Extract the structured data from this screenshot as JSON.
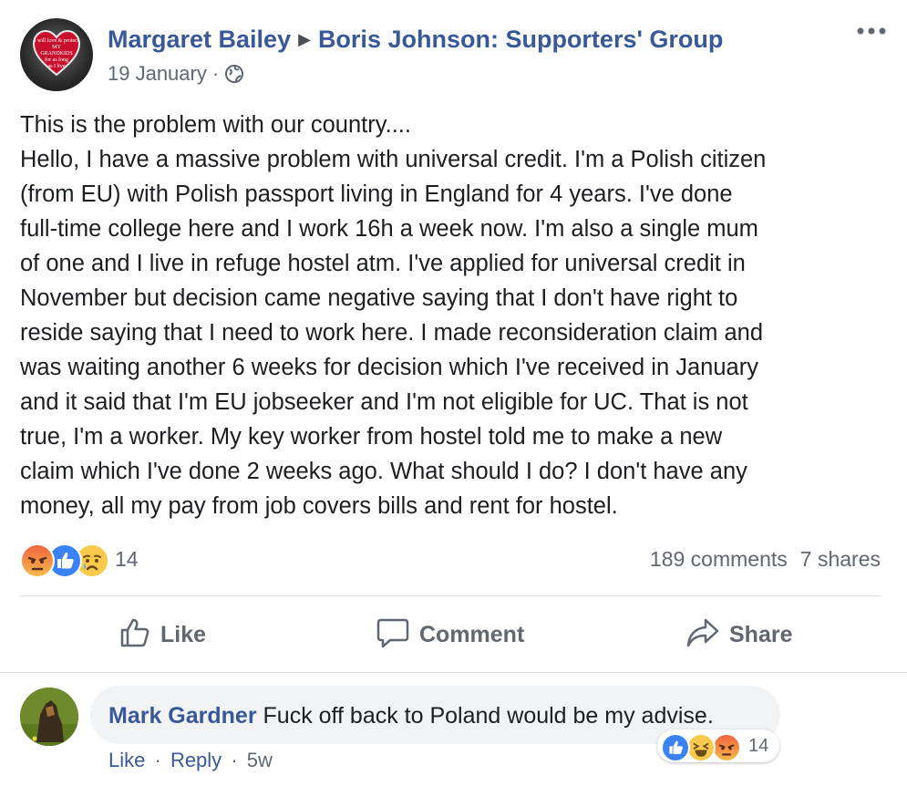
{
  "post": {
    "author": "Margaret Bailey",
    "group": "Boris Johnson: Supporters' Group",
    "date": "19 January",
    "date_separator": "·",
    "privacy_icon": "globe-icon",
    "more_icon": "more-options-icon",
    "avatar_text": [
      "I will love & protect",
      "MY",
      "GRANDKIDS",
      "for as long",
      "as I live"
    ],
    "body": [
      "This is the problem with our country....",
      "Hello, I have a massive problem with universal credit. I'm a Polish citizen",
      "(from EU) with Polish passport living in England for 4 years. I've done",
      "full-time college here and I work 16h a week now. I'm also a single mum",
      "of one and I live in refuge hostel atm. I've applied for universal credit in",
      "November but decision came negative saying that I don't have right to",
      "reside saying that I need to work here. I made reconsideration claim and",
      "was waiting another 6 weeks for decision which I've received in January",
      "and it said that I'm EU jobseeker and I'm not eligible for UC. That is not",
      "true, I'm a worker. My key worker from hostel told me to make a new",
      "claim which I've done 2 weeks ago. What should I do? I don't have any",
      "money, all my pay from job covers bills and rent for hostel."
    ],
    "reactions": [
      "angry",
      "like",
      "sad"
    ],
    "reaction_count": "14",
    "comments_count": "189 comments",
    "shares_count": "7 shares"
  },
  "actions": {
    "like": "Like",
    "comment": "Comment",
    "share": "Share"
  },
  "comment": {
    "author": "Mark Gardner",
    "text": "Fuck off back to Poland would be my advise.",
    "reactions": [
      "like",
      "haha",
      "angry"
    ],
    "reaction_count": "14",
    "like_label": "Like",
    "reply_label": "Reply",
    "separator": "·",
    "time": "5w"
  },
  "colors": {
    "link": "#385898",
    "secondary_text": "#606770",
    "like_blue": "#3b82f6",
    "divider": "#dadde1"
  }
}
